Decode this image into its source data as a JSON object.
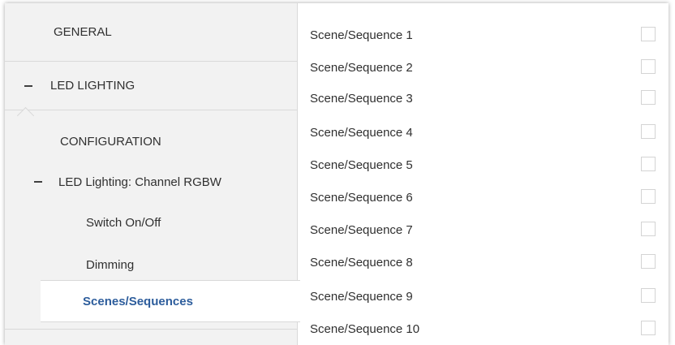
{
  "sidebar": {
    "general": "GENERAL",
    "led_lighting": "LED LIGHTING",
    "configuration": "CONFIGURATION",
    "channel": "LED Lighting: Channel RGBW",
    "switch": "Switch On/Off",
    "dimming": "Dimming",
    "scenes": "Scenes/Sequences"
  },
  "list": {
    "rows": [
      {
        "label": "Scene/Sequence 1",
        "checked": false
      },
      {
        "label": "Scene/Sequence 2",
        "checked": false
      },
      {
        "label": "Scene/Sequence 3",
        "checked": false
      },
      {
        "label": "Scene/Sequence 4",
        "checked": false
      },
      {
        "label": "Scene/Sequence 5",
        "checked": false
      },
      {
        "label": "Scene/Sequence 6",
        "checked": false
      },
      {
        "label": "Scene/Sequence 7",
        "checked": false
      },
      {
        "label": "Scene/Sequence 8",
        "checked": false
      },
      {
        "label": "Scene/Sequence 9",
        "checked": false
      },
      {
        "label": "Scene/Sequence 10",
        "checked": false
      }
    ]
  },
  "colors": {
    "selected_text": "#2d5d9c",
    "sidebar_bg": "#f2f2f2"
  }
}
